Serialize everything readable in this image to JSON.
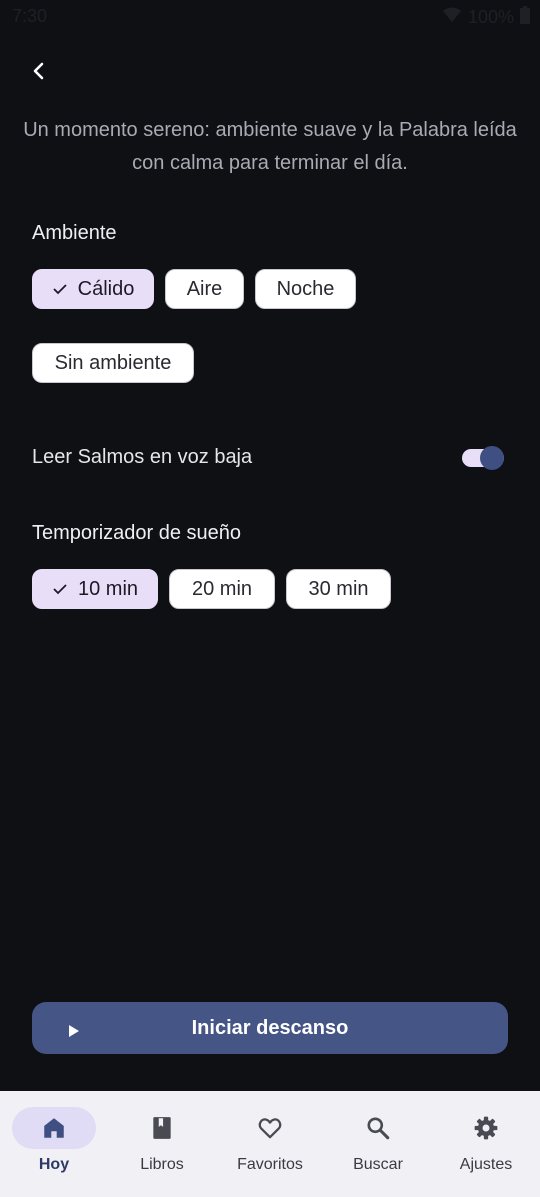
{
  "status_bar": {
    "time": "7:30",
    "battery": "100%"
  },
  "intro_text": "Un momento sereno: ambiente suave y la Palabra leída con calma para terminar el día.",
  "ambiente": {
    "label": "Ambiente",
    "options": [
      "Cálido",
      "Aire",
      "Noche",
      "Sin ambiente"
    ],
    "selected": "Cálido"
  },
  "psalms_toggle": {
    "label": "Leer Salmos en voz baja",
    "on": true
  },
  "sleep_timer": {
    "label": "Temporizador de sueño",
    "options": [
      "10 min",
      "20 min",
      "30 min"
    ],
    "selected": "10 min"
  },
  "start_button": {
    "label": "Iniciar descanso"
  },
  "bottom_nav": {
    "items": [
      {
        "label": "Hoy",
        "icon": "home-icon",
        "active": true
      },
      {
        "label": "Libros",
        "icon": "book-icon",
        "active": false
      },
      {
        "label": "Favoritos",
        "icon": "heart-icon",
        "active": false
      },
      {
        "label": "Buscar",
        "icon": "search-icon",
        "active": false
      },
      {
        "label": "Ajustes",
        "icon": "gear-icon",
        "active": false
      }
    ]
  },
  "colors": {
    "background": "#0e1014",
    "chip_selected": "#e8def8",
    "accent": "#455585",
    "nav_background": "#f1f1f5"
  }
}
